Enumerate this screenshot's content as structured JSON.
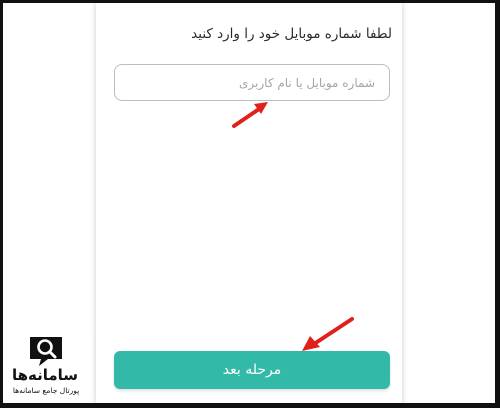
{
  "form": {
    "prompt": "لطفا شماره موبایل خود را وارد کنید",
    "phone_input": {
      "value": "",
      "placeholder": "شماره موبایل یا نام کاربری"
    },
    "next_button_label": "مرحله بعد"
  },
  "watermark": {
    "name": "سامانه‌ها",
    "tagline": "پورتال جامع سامانه‌ها"
  },
  "colors": {
    "accent": "#33b9a8",
    "annotation_arrow": "#e0201b",
    "input_border": "#bdbdbd"
  },
  "icons": {
    "annotation": "red-arrow-icon",
    "logo": "magnifier-logo-icon"
  }
}
